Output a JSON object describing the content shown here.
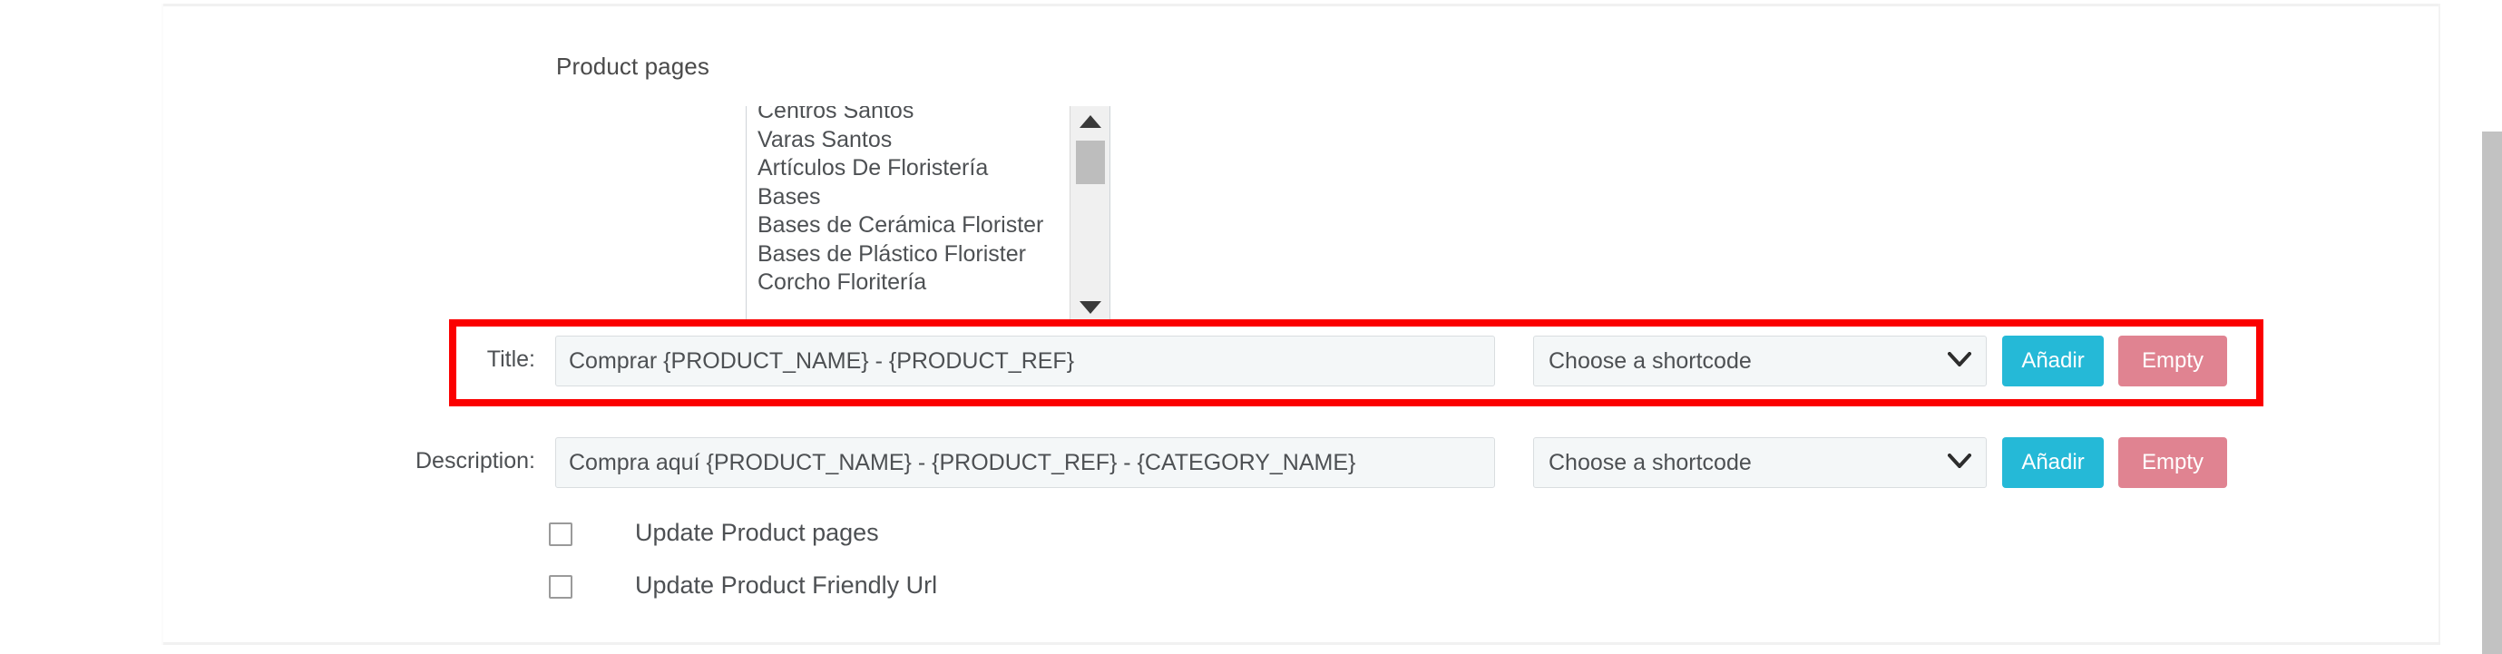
{
  "section": {
    "heading": "Product pages"
  },
  "product_pages_listbox": {
    "name": "product-categories-listbox",
    "options": [
      "Centros Santos",
      "Varas Santos",
      "Artículos De Floristería",
      "Bases",
      "Bases de Cerámica Florister",
      "Bases de Plástico Florister",
      "Corcho Floritería"
    ],
    "scroll_up_icon": "triangle-up-icon",
    "scroll_down_icon": "triangle-down-icon"
  },
  "rows": {
    "title": {
      "label": "Title:",
      "input_value": "Comprar {PRODUCT_NAME} - {PRODUCT_REF}",
      "input_placeholder": "",
      "select_value": "Choose a shortcode",
      "select_icon": "chevron-down-icon",
      "add_button": "Añadir",
      "empty_button": "Empty"
    },
    "description": {
      "label": "Description:",
      "input_value": "Compra aquí {PRODUCT_NAME} - {PRODUCT_REF} - {CATEGORY_NAME}",
      "input_placeholder": "",
      "select_value": "Choose a shortcode",
      "select_icon": "chevron-down-icon",
      "add_button": "Añadir",
      "empty_button": "Empty"
    }
  },
  "checkboxes": [
    {
      "label": "Update Product pages",
      "checked": false
    },
    {
      "label": "Update Product Friendly Url",
      "checked": false
    }
  ],
  "colors": {
    "highlight_rect": "#fb0000",
    "add_button": "#25b9d7",
    "empty_button": "#e08391",
    "input_background": "#f4f7f8",
    "input_border": "#d9dde0",
    "text": "#4d5053",
    "scrollbar_thumb": "#c2c2c2"
  }
}
